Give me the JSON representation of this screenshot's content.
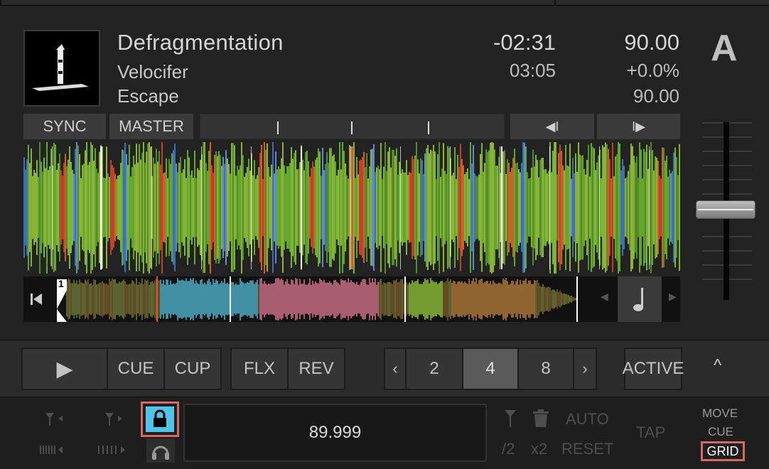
{
  "track": {
    "title": "Defragmentation",
    "artist": "Velocifer",
    "album": "Escape",
    "time_remaining": "-02:31",
    "time_total": "03:05",
    "bpm": "90.00",
    "pitch": "+0.0%",
    "bpm_original": "90.00"
  },
  "deck": {
    "letter": "A"
  },
  "header_buttons": {
    "sync": "SYNC",
    "master": "MASTER",
    "beatjump_back": "◀I",
    "beatjump_forward": "I▶"
  },
  "overview": {
    "cue_number": "1"
  },
  "transport": {
    "play": "▶",
    "cue": "CUE",
    "cup": "CUP",
    "flux": "FLX",
    "reverse": "REV",
    "loop_prev": "‹",
    "loop_sizes": [
      "2",
      "4",
      "8"
    ],
    "loop_selected": "4",
    "loop_next": "›",
    "active": "ACTIVE",
    "collapse": "^"
  },
  "grid_panel": {
    "bpm_value": "89.999",
    "tap": "TAP",
    "auto": "AUTO",
    "reset": "RESET",
    "half": "/2",
    "double": "x2",
    "move": "MOVE",
    "cue": "CUE",
    "grid": "GRID"
  },
  "colors": {
    "accent_lock": "#4fc3ea",
    "highlight_border": "#d9685f",
    "playhead": "#e3552c"
  }
}
